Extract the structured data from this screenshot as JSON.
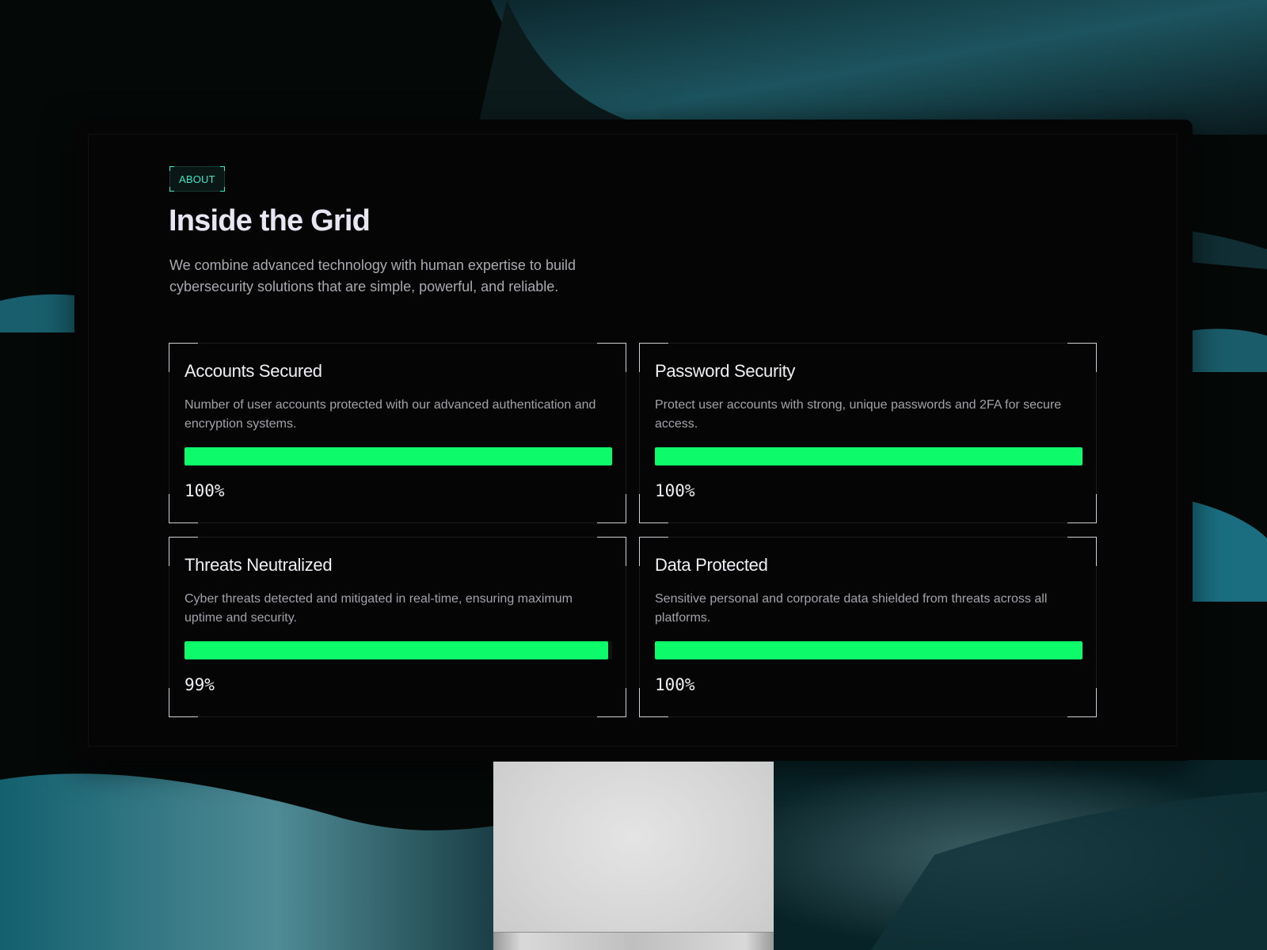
{
  "about_tag": "ABOUT",
  "title": "Inside the Grid",
  "intro": "We combine advanced technology with human expertise to build cybersecurity solutions that are simple, powerful, and reliable.",
  "cards": [
    {
      "title": "Accounts Secured",
      "description": "Number of user accounts protected with our advanced authentication and encryption systems.",
      "percent_label": "100%",
      "progress": 100
    },
    {
      "title": "Password Security",
      "description": "Protect user accounts with strong, unique passwords and 2FA for secure access.",
      "percent_label": "100%",
      "progress": 100
    },
    {
      "title": "Threats Neutralized",
      "description": "Cyber threats detected and mitigated in real-time, ensuring maximum uptime and security.",
      "percent_label": "99%",
      "progress": 99
    },
    {
      "title": "Data Protected",
      "description": "Sensitive personal and corporate data shielded from threats across all platforms.",
      "percent_label": "100%",
      "progress": 100
    }
  ],
  "colors": {
    "accent": "#3fe6c8",
    "progress": "#0dfa6b",
    "background": "#050505"
  }
}
